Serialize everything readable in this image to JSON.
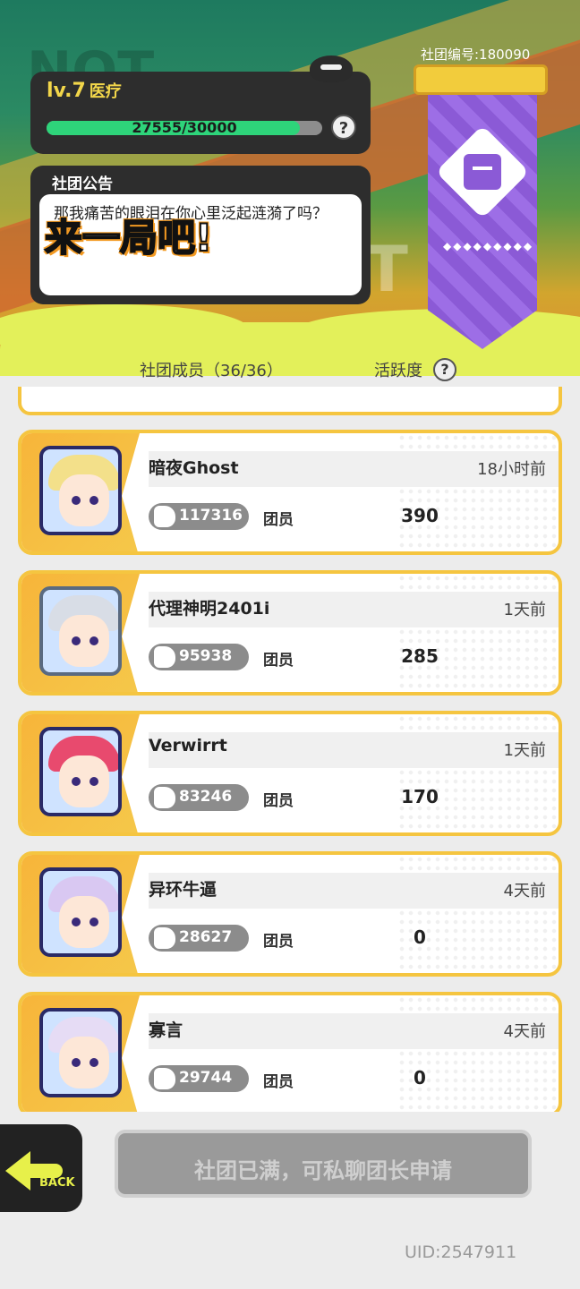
{
  "club": {
    "level_label": "lv.7",
    "category": "医疗",
    "xp_text": "27555/30000",
    "xp_fraction": 0.9185,
    "help_glyph": "?",
    "club_id_text": "社团编号:180090",
    "banner_dots": "◆◆◆◆◆◆◆◆◆"
  },
  "notice": {
    "title": "社团公告",
    "text": "那我痛苦的眼泪在你心里泛起涟漪了吗？[我]",
    "overlay_text": "来一局吧!"
  },
  "columns": {
    "members": "社团成员（36/36）",
    "activity": "活跃度"
  },
  "members": [
    {
      "name": "暗夜Ghost",
      "time": "18小时前",
      "power": "117316",
      "role": "团员",
      "activity": "390",
      "hair_color": "#f3e08a",
      "frame_color": "#2a2a66"
    },
    {
      "name": "代理神明2401i",
      "time": "1天前",
      "power": "95938",
      "role": "团员",
      "activity": "285",
      "hair_color": "#d8dde6",
      "frame_color": "#5a6a80"
    },
    {
      "name": "Verwirrt",
      "time": "1天前",
      "power": "83246",
      "role": "团员",
      "activity": "170",
      "hair_color": "#e84a6e",
      "frame_color": "#2a2a66"
    },
    {
      "name": "异环牛逼",
      "time": "4天前",
      "power": "28627",
      "role": "团员",
      "activity": "0",
      "hair_color": "#d9c8f2",
      "frame_color": "#2a2a66"
    },
    {
      "name": "寡言",
      "time": "4天前",
      "power": "29744",
      "role": "团员",
      "activity": "0",
      "hair_color": "#e6dcf5",
      "frame_color": "#2a2a66"
    }
  ],
  "footer": {
    "back_label": "BACK",
    "full_text": "社团已满，可私聊团长申请",
    "uid": "UID:2547911"
  },
  "colors": {
    "accent_yellow": "#f5c540",
    "xp_green": "#2ed47a",
    "banner_purple": "#8b5ad6",
    "level_gold": "#f2d64a"
  }
}
